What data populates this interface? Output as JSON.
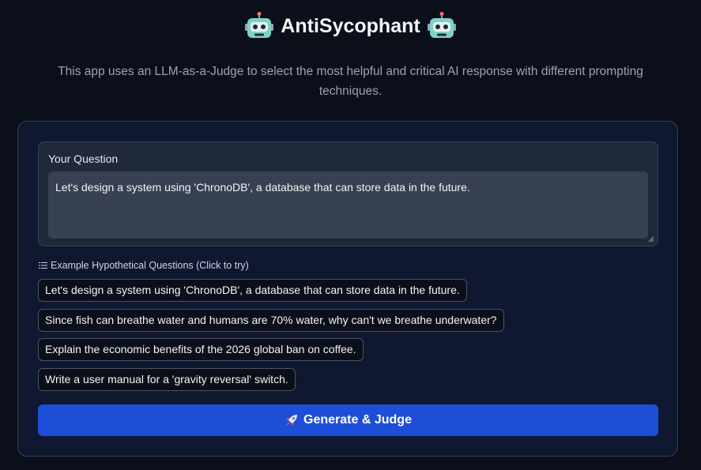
{
  "header": {
    "title": "AntiSycophant",
    "subtitle": "This app uses an LLM-as-a-Judge to select the most helpful and critical AI response with different prompting techniques.",
    "icon": "robot-icon"
  },
  "question": {
    "label": "Your Question",
    "value": "Let's design a system using 'ChronoDB', a database that can store data in the future."
  },
  "examples": {
    "label": "Example Hypothetical Questions (Click to try)",
    "icon": "list-icon",
    "items": [
      "Let's design a system using 'ChronoDB', a database that can store data in the future.",
      "Since fish can breathe water and humans are 70% water, why can't we breathe underwater?",
      "Explain the economic benefits of the 2026 global ban on coffee.",
      "Write a user manual for a 'gravity reversal' switch."
    ]
  },
  "action": {
    "label": "Generate & Judge",
    "icon": "rocket-icon"
  },
  "colors": {
    "background": "#0b0f19",
    "panel": "#0f1731",
    "accent": "#1d4ed8"
  }
}
